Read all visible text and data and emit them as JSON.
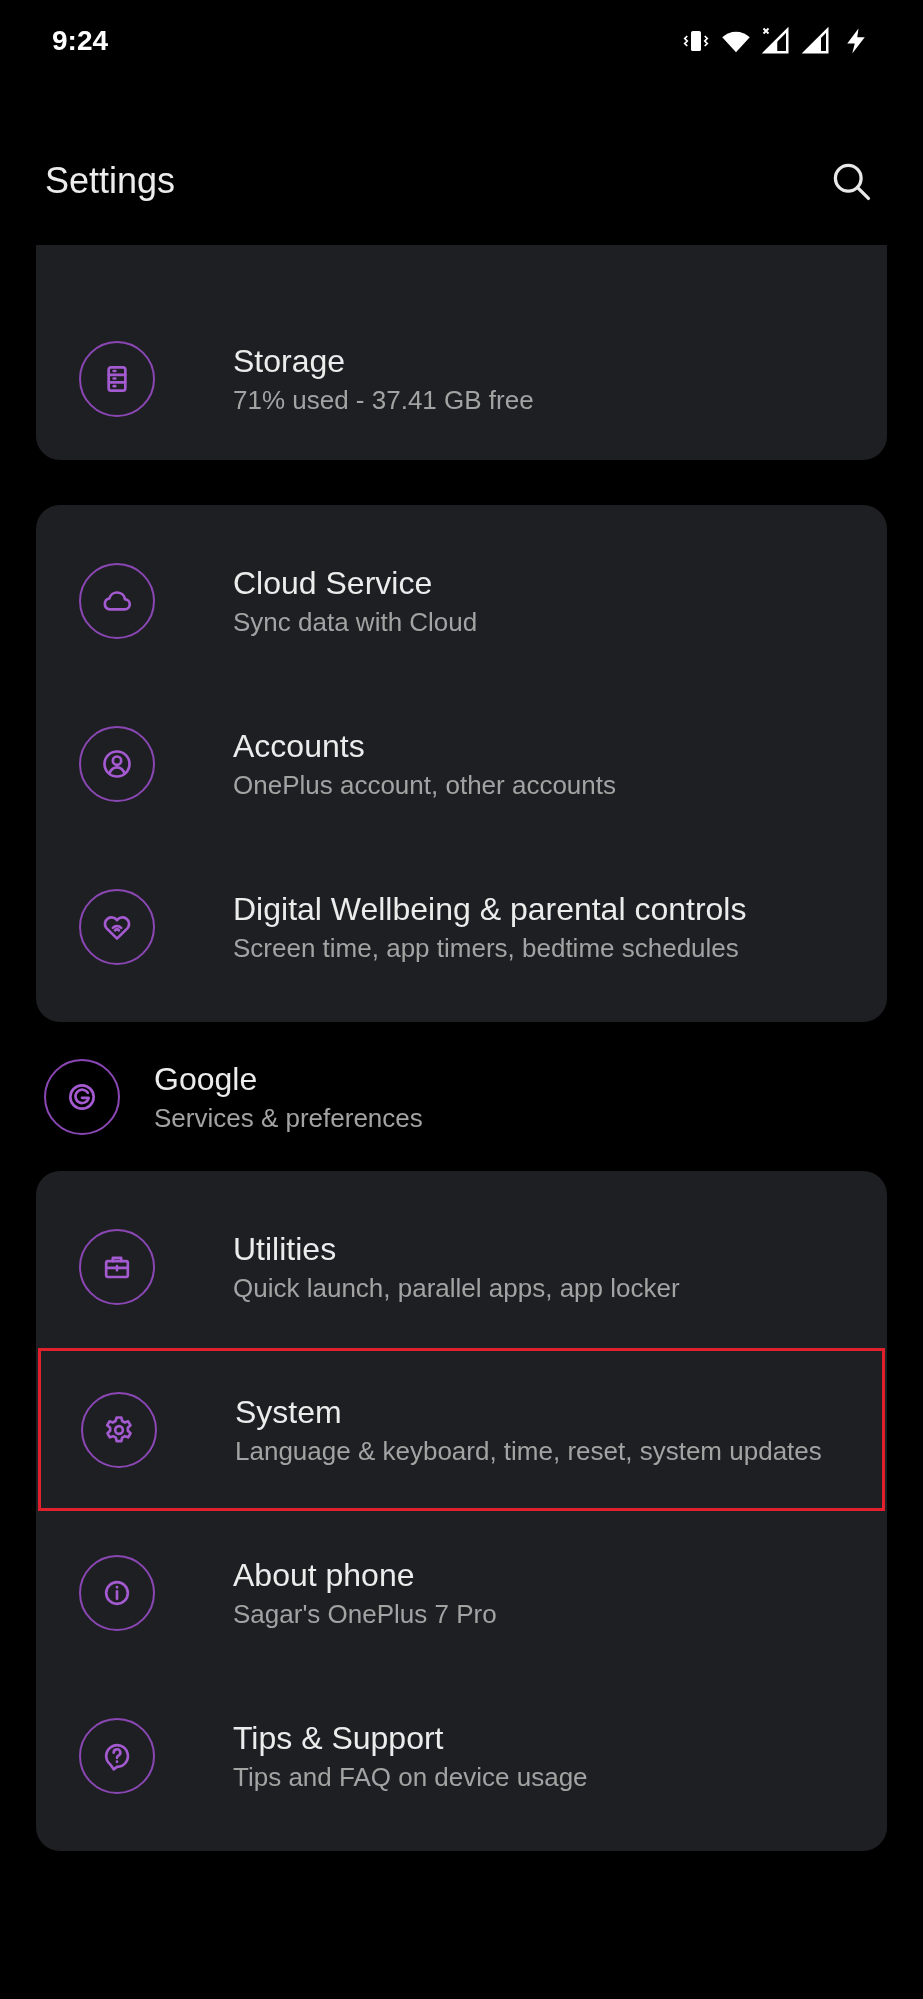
{
  "status_bar": {
    "time": "9:24"
  },
  "header": {
    "title": "Settings"
  },
  "sections": [
    {
      "kind": "card",
      "items": [
        {
          "title": "Storage",
          "subtitle": "71% used - 37.41 GB free",
          "highlighted": false
        }
      ]
    },
    {
      "kind": "card",
      "items": [
        {
          "title": "Cloud Service",
          "subtitle": "Sync data with Cloud",
          "highlighted": false
        },
        {
          "title": "Accounts",
          "subtitle": "OnePlus account, other accounts",
          "highlighted": false
        },
        {
          "title": "Digital Wellbeing & parental controls",
          "subtitle": "Screen time, app timers, bedtime schedules",
          "highlighted": false
        }
      ]
    },
    {
      "kind": "plain",
      "items": [
        {
          "title": "Google",
          "subtitle": "Services & preferences",
          "highlighted": false
        }
      ]
    },
    {
      "kind": "card",
      "items": [
        {
          "title": "Utilities",
          "subtitle": "Quick launch, parallel apps, app locker",
          "highlighted": false
        },
        {
          "title": "System",
          "subtitle": "Language & keyboard, time, reset, system updates",
          "highlighted": true
        },
        {
          "title": "About phone",
          "subtitle": "Sagar's OnePlus 7 Pro",
          "highlighted": false
        },
        {
          "title": "Tips & Support",
          "subtitle": "Tips and FAQ on device usage",
          "highlighted": false
        }
      ]
    }
  ]
}
